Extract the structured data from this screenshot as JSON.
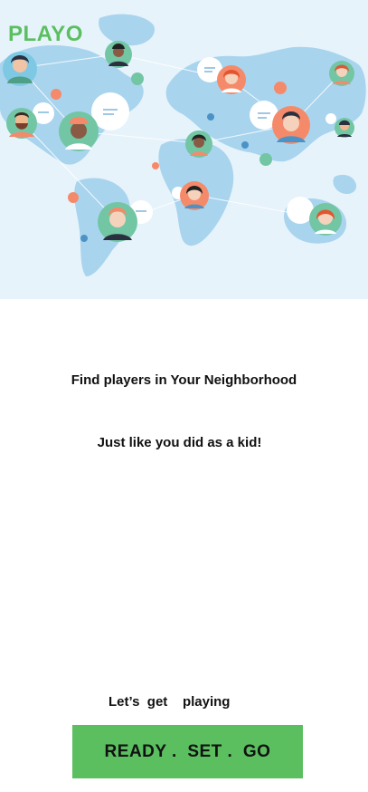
{
  "app": {
    "brand": "PLAYO"
  },
  "hero": {
    "illustration": "world-map-with-connected-people",
    "colors": {
      "background": "#e6f3fb",
      "land": "#a7d3ee",
      "accent_orange": "#f58a6a",
      "accent_green": "#72c6a4",
      "accent_blue": "#4b93c6"
    }
  },
  "content": {
    "headline": "Find players in Your Neighborhood",
    "subline": "Just like you did as a kid!"
  },
  "footer": {
    "tagline": "Let’s  get    playing",
    "cta_label": "READY .  SET .  GO"
  },
  "theme": {
    "brand_green": "#5bbf60",
    "text": "#111111"
  }
}
